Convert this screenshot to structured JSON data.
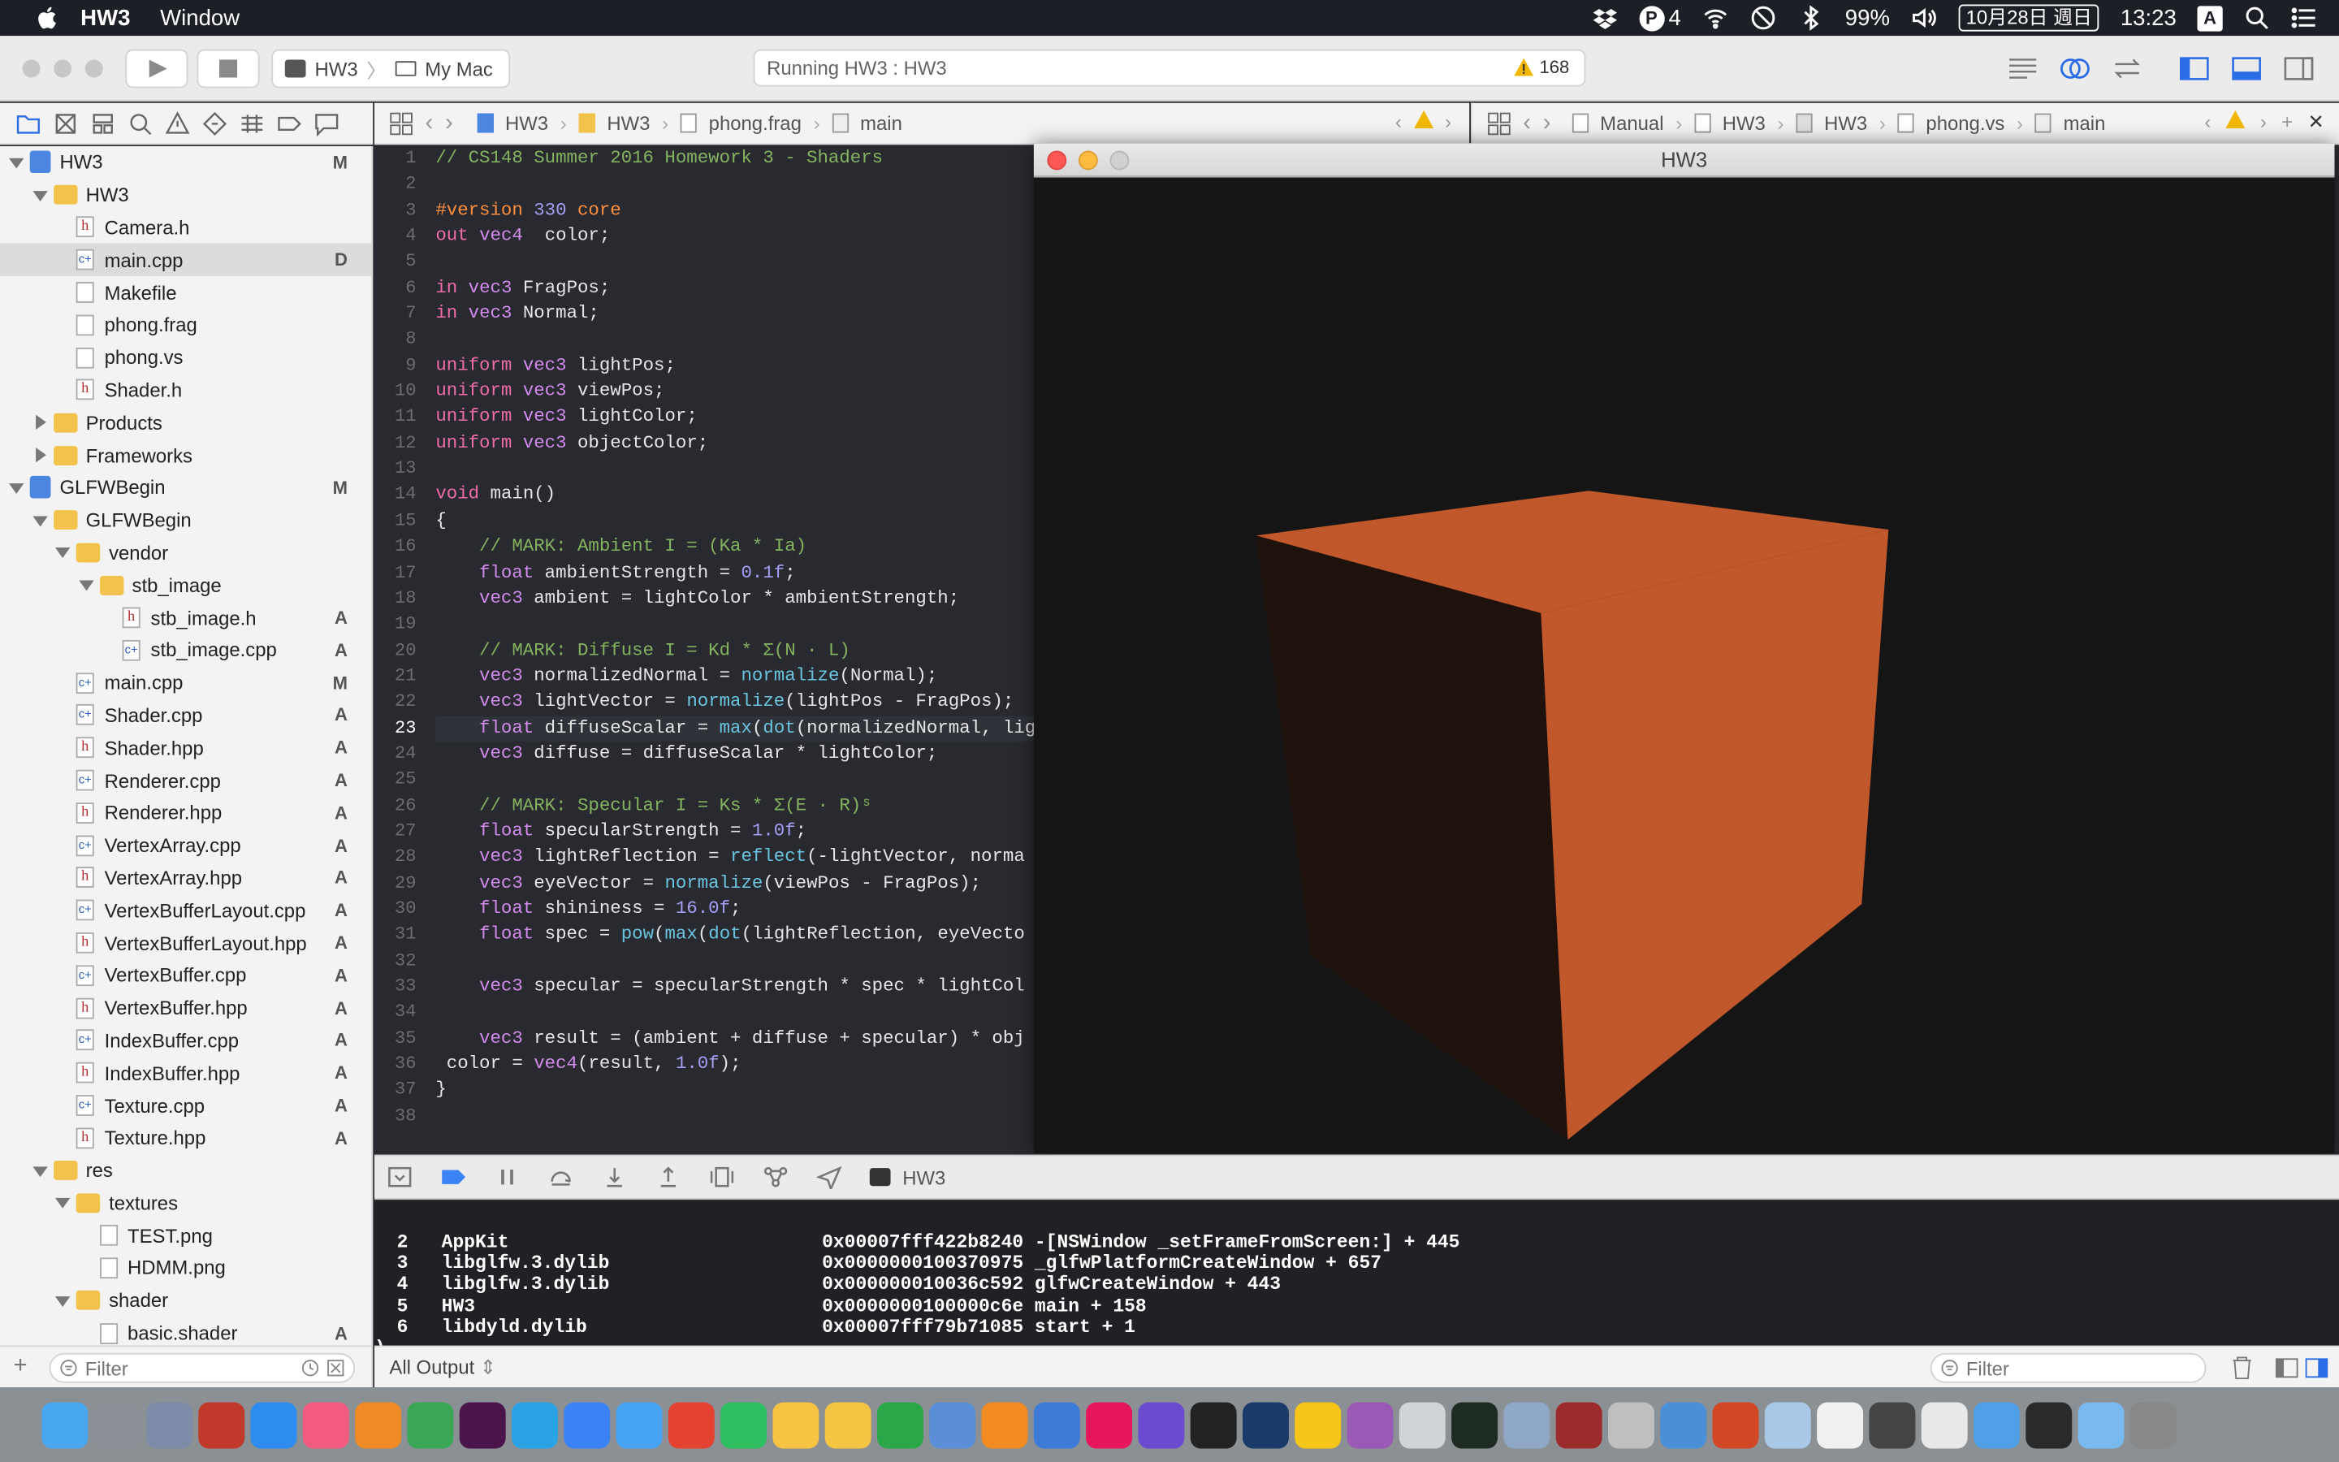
{
  "menubar": {
    "app": "HW3",
    "items": [
      "Window"
    ],
    "input_badge": "4",
    "battery": "99%",
    "date": "10月28日 週日",
    "time": "13:23",
    "input_mode": "A"
  },
  "toolbar": {
    "scheme_target": "HW3",
    "scheme_device": "My Mac",
    "activity": "Running HW3 : HW3",
    "warnings": "168"
  },
  "jumpbar_left": [
    "HW3",
    "HW3",
    "phong.frag",
    "main"
  ],
  "jumpbar_right": [
    "Manual",
    "HW3",
    "HW3",
    "phong.vs",
    "main"
  ],
  "tree": [
    {
      "label": "HW3",
      "level": 0,
      "kind": "project",
      "open": true,
      "status": "M"
    },
    {
      "label": "HW3",
      "level": 1,
      "kind": "folder",
      "open": true,
      "status": ""
    },
    {
      "label": "Camera.h",
      "level": 2,
      "kind": "h",
      "status": ""
    },
    {
      "label": "main.cpp",
      "level": 2,
      "kind": "c",
      "status": "D",
      "selected": true
    },
    {
      "label": "Makefile",
      "level": 2,
      "kind": "p",
      "status": ""
    },
    {
      "label": "phong.frag",
      "level": 2,
      "kind": "p",
      "status": ""
    },
    {
      "label": "phong.vs",
      "level": 2,
      "kind": "p",
      "status": ""
    },
    {
      "label": "Shader.h",
      "level": 2,
      "kind": "h",
      "status": ""
    },
    {
      "label": "Products",
      "level": 1,
      "kind": "folder",
      "open": false,
      "status": ""
    },
    {
      "label": "Frameworks",
      "level": 1,
      "kind": "folder",
      "open": false,
      "status": ""
    },
    {
      "label": "GLFWBegin",
      "level": 0,
      "kind": "project",
      "open": true,
      "status": "M"
    },
    {
      "label": "GLFWBegin",
      "level": 1,
      "kind": "folder",
      "open": true,
      "status": ""
    },
    {
      "label": "vendor",
      "level": 2,
      "kind": "folder",
      "open": true,
      "status": ""
    },
    {
      "label": "stb_image",
      "level": 3,
      "kind": "folder",
      "open": true,
      "status": ""
    },
    {
      "label": "stb_image.h",
      "level": 4,
      "kind": "h",
      "status": "A"
    },
    {
      "label": "stb_image.cpp",
      "level": 4,
      "kind": "c",
      "status": "A"
    },
    {
      "label": "main.cpp",
      "level": 2,
      "kind": "c",
      "status": "M"
    },
    {
      "label": "Shader.cpp",
      "level": 2,
      "kind": "c",
      "status": "A"
    },
    {
      "label": "Shader.hpp",
      "level": 2,
      "kind": "h",
      "status": "A"
    },
    {
      "label": "Renderer.cpp",
      "level": 2,
      "kind": "c",
      "status": "A"
    },
    {
      "label": "Renderer.hpp",
      "level": 2,
      "kind": "h",
      "status": "A"
    },
    {
      "label": "VertexArray.cpp",
      "level": 2,
      "kind": "c",
      "status": "A"
    },
    {
      "label": "VertexArray.hpp",
      "level": 2,
      "kind": "h",
      "status": "A"
    },
    {
      "label": "VertexBufferLayout.cpp",
      "level": 2,
      "kind": "c",
      "status": "A"
    },
    {
      "label": "VertexBufferLayout.hpp",
      "level": 2,
      "kind": "h",
      "status": "A"
    },
    {
      "label": "VertexBuffer.cpp",
      "level": 2,
      "kind": "c",
      "status": "A"
    },
    {
      "label": "VertexBuffer.hpp",
      "level": 2,
      "kind": "h",
      "status": "A"
    },
    {
      "label": "IndexBuffer.cpp",
      "level": 2,
      "kind": "c",
      "status": "A"
    },
    {
      "label": "IndexBuffer.hpp",
      "level": 2,
      "kind": "h",
      "status": "A"
    },
    {
      "label": "Texture.cpp",
      "level": 2,
      "kind": "c",
      "status": "A"
    },
    {
      "label": "Texture.hpp",
      "level": 2,
      "kind": "h",
      "status": "A"
    },
    {
      "label": "res",
      "level": 1,
      "kind": "folder",
      "open": true,
      "status": ""
    },
    {
      "label": "textures",
      "level": 2,
      "kind": "folder",
      "open": true,
      "status": ""
    },
    {
      "label": "TEST.png",
      "level": 3,
      "kind": "p",
      "status": ""
    },
    {
      "label": "HDMM.png",
      "level": 3,
      "kind": "p",
      "status": ""
    },
    {
      "label": "shader",
      "level": 2,
      "kind": "folder",
      "open": true,
      "status": ""
    },
    {
      "label": "basic.shader",
      "level": 3,
      "kind": "p",
      "status": "A"
    }
  ],
  "sidebar_filter_placeholder": "Filter",
  "editor": {
    "current_line": 23,
    "lines": [
      [
        [
          "c",
          "// CS148 Summer 2016 Homework 3 - Shaders"
        ]
      ],
      [],
      [
        [
          "pp",
          "#version "
        ],
        [
          "n",
          "330"
        ],
        [
          "pp",
          " core"
        ]
      ],
      [
        [
          "k",
          "out "
        ],
        [
          "t",
          "vec4"
        ],
        [
          "",
          "  color;"
        ]
      ],
      [],
      [
        [
          "k",
          "in "
        ],
        [
          "t",
          "vec3"
        ],
        [
          "",
          " FragPos;"
        ]
      ],
      [
        [
          "k",
          "in "
        ],
        [
          "t",
          "vec3"
        ],
        [
          "",
          " Normal;"
        ]
      ],
      [],
      [
        [
          "k",
          "uniform "
        ],
        [
          "t",
          "vec3"
        ],
        [
          "",
          " lightPos;"
        ]
      ],
      [
        [
          "k",
          "uniform "
        ],
        [
          "t",
          "vec3"
        ],
        [
          "",
          " viewPos;"
        ]
      ],
      [
        [
          "k",
          "uniform "
        ],
        [
          "t",
          "vec3"
        ],
        [
          "",
          " lightColor;"
        ]
      ],
      [
        [
          "k",
          "uniform "
        ],
        [
          "t",
          "vec3"
        ],
        [
          "",
          " objectColor;"
        ]
      ],
      [],
      [
        [
          "k",
          "void"
        ],
        [
          "",
          " main()"
        ]
      ],
      [
        [
          "",
          "{"
        ]
      ],
      [
        [
          "c",
          "    // MARK: Ambient I = (Ka * Ia)"
        ]
      ],
      [
        [
          "t",
          "    float"
        ],
        [
          "",
          " ambientStrength = "
        ],
        [
          "n",
          "0.1f"
        ],
        [
          "",
          ";"
        ]
      ],
      [
        [
          "t",
          "    vec3"
        ],
        [
          "",
          " ambient = lightColor * ambientStrength;"
        ]
      ],
      [],
      [
        [
          "c",
          "    // MARK: Diffuse I = Kd * Σ(N · L)"
        ]
      ],
      [
        [
          "t",
          "    vec3"
        ],
        [
          "",
          " normalizedNormal = "
        ],
        [
          "f",
          "normalize"
        ],
        [
          "",
          "(Normal);"
        ]
      ],
      [
        [
          "t",
          "    vec3"
        ],
        [
          "",
          " lightVector = "
        ],
        [
          "f",
          "normalize"
        ],
        [
          "",
          "(lightPos - FragPos);"
        ]
      ],
      [
        [
          "t",
          "    float"
        ],
        [
          "",
          " diffuseScalar = "
        ],
        [
          "f",
          "max"
        ],
        [
          "",
          "("
        ],
        [
          "f",
          "dot"
        ],
        [
          "",
          "(normalizedNormal, lig"
        ]
      ],
      [
        [
          "t",
          "    vec3"
        ],
        [
          "",
          " diffuse = diffuseScalar * lightColor;"
        ]
      ],
      [],
      [
        [
          "c",
          "    // MARK: Specular I = Ks * Σ(E · R)ˢ"
        ]
      ],
      [
        [
          "t",
          "    float"
        ],
        [
          "",
          " specularStrength = "
        ],
        [
          "n",
          "1.0f"
        ],
        [
          "",
          ";"
        ]
      ],
      [
        [
          "t",
          "    vec3"
        ],
        [
          "",
          " lightReflection = "
        ],
        [
          "f",
          "reflect"
        ],
        [
          "",
          "(-lightVector, norma"
        ]
      ],
      [
        [
          "t",
          "    vec3"
        ],
        [
          "",
          " eyeVector = "
        ],
        [
          "f",
          "normalize"
        ],
        [
          "",
          "(viewPos - FragPos);"
        ]
      ],
      [
        [
          "t",
          "    float"
        ],
        [
          "",
          " shininess = "
        ],
        [
          "n",
          "16.0f"
        ],
        [
          "",
          ";"
        ]
      ],
      [
        [
          "t",
          "    float"
        ],
        [
          "",
          " spec = "
        ],
        [
          "f",
          "pow"
        ],
        [
          "",
          "("
        ],
        [
          "f",
          "max"
        ],
        [
          "",
          "("
        ],
        [
          "f",
          "dot"
        ],
        [
          "",
          "(lightReflection, eyeVecto"
        ]
      ],
      [],
      [
        [
          "t",
          "    vec3"
        ],
        [
          "",
          " specular = specularStrength * spec * lightCol"
        ]
      ],
      [],
      [
        [
          "t",
          "    vec3"
        ],
        [
          "",
          " result = (ambient + diffuse + specular) * obj"
        ]
      ],
      [
        [
          "",
          " color = "
        ],
        [
          "t",
          "vec4"
        ],
        [
          "",
          "(result, "
        ],
        [
          "n",
          "1.0f"
        ],
        [
          "",
          ");"
        ]
      ],
      [
        [
          "",
          "}"
        ]
      ],
      []
    ]
  },
  "gl_window": {
    "title": "HW3",
    "cube_color": "#c0582c"
  },
  "debugbar": {
    "process": "HW3"
  },
  "console_lines": [
    "  2   AppKit                            0x00007fff422b8240 -[NSWindow _setFrameFromScreen:] + 445",
    "  3   libglfw.3.dylib                   0x0000000100370975 _glfwPlatformCreateWindow + 657",
    "  4   libglfw.3.dylib                   0x000000010036c592 glfwCreateWindow + 443",
    "  5   HW3                               0x0000000100000c6e main + 158",
    "  6   libdyld.dylib                     0x00007fff79b71085 start + 1",
    ")"
  ],
  "bottombar": {
    "output_selector": "All Output",
    "filter_placeholder": "Filter"
  },
  "dock": {
    "apps": [
      "finder",
      "system-preferences",
      "launchpad",
      "toolbox",
      "app-store",
      "music",
      "books",
      "chrome",
      "slack",
      "tweetbot",
      "safari-ish",
      "messages",
      "todoist",
      "evernote",
      "photos",
      "notes",
      "numbers",
      "keynote",
      "sublime",
      "xcode",
      "intellij",
      "dash",
      "terminal",
      "qq",
      "cyberduck",
      "github-desktop",
      "instruments",
      "activity-monitor",
      "preview",
      "dictionary",
      "pen",
      "pasta",
      "powerpoint",
      "box",
      "textedit",
      "console",
      "finder-files",
      "folder",
      "screen",
      "files",
      "trash"
    ]
  }
}
